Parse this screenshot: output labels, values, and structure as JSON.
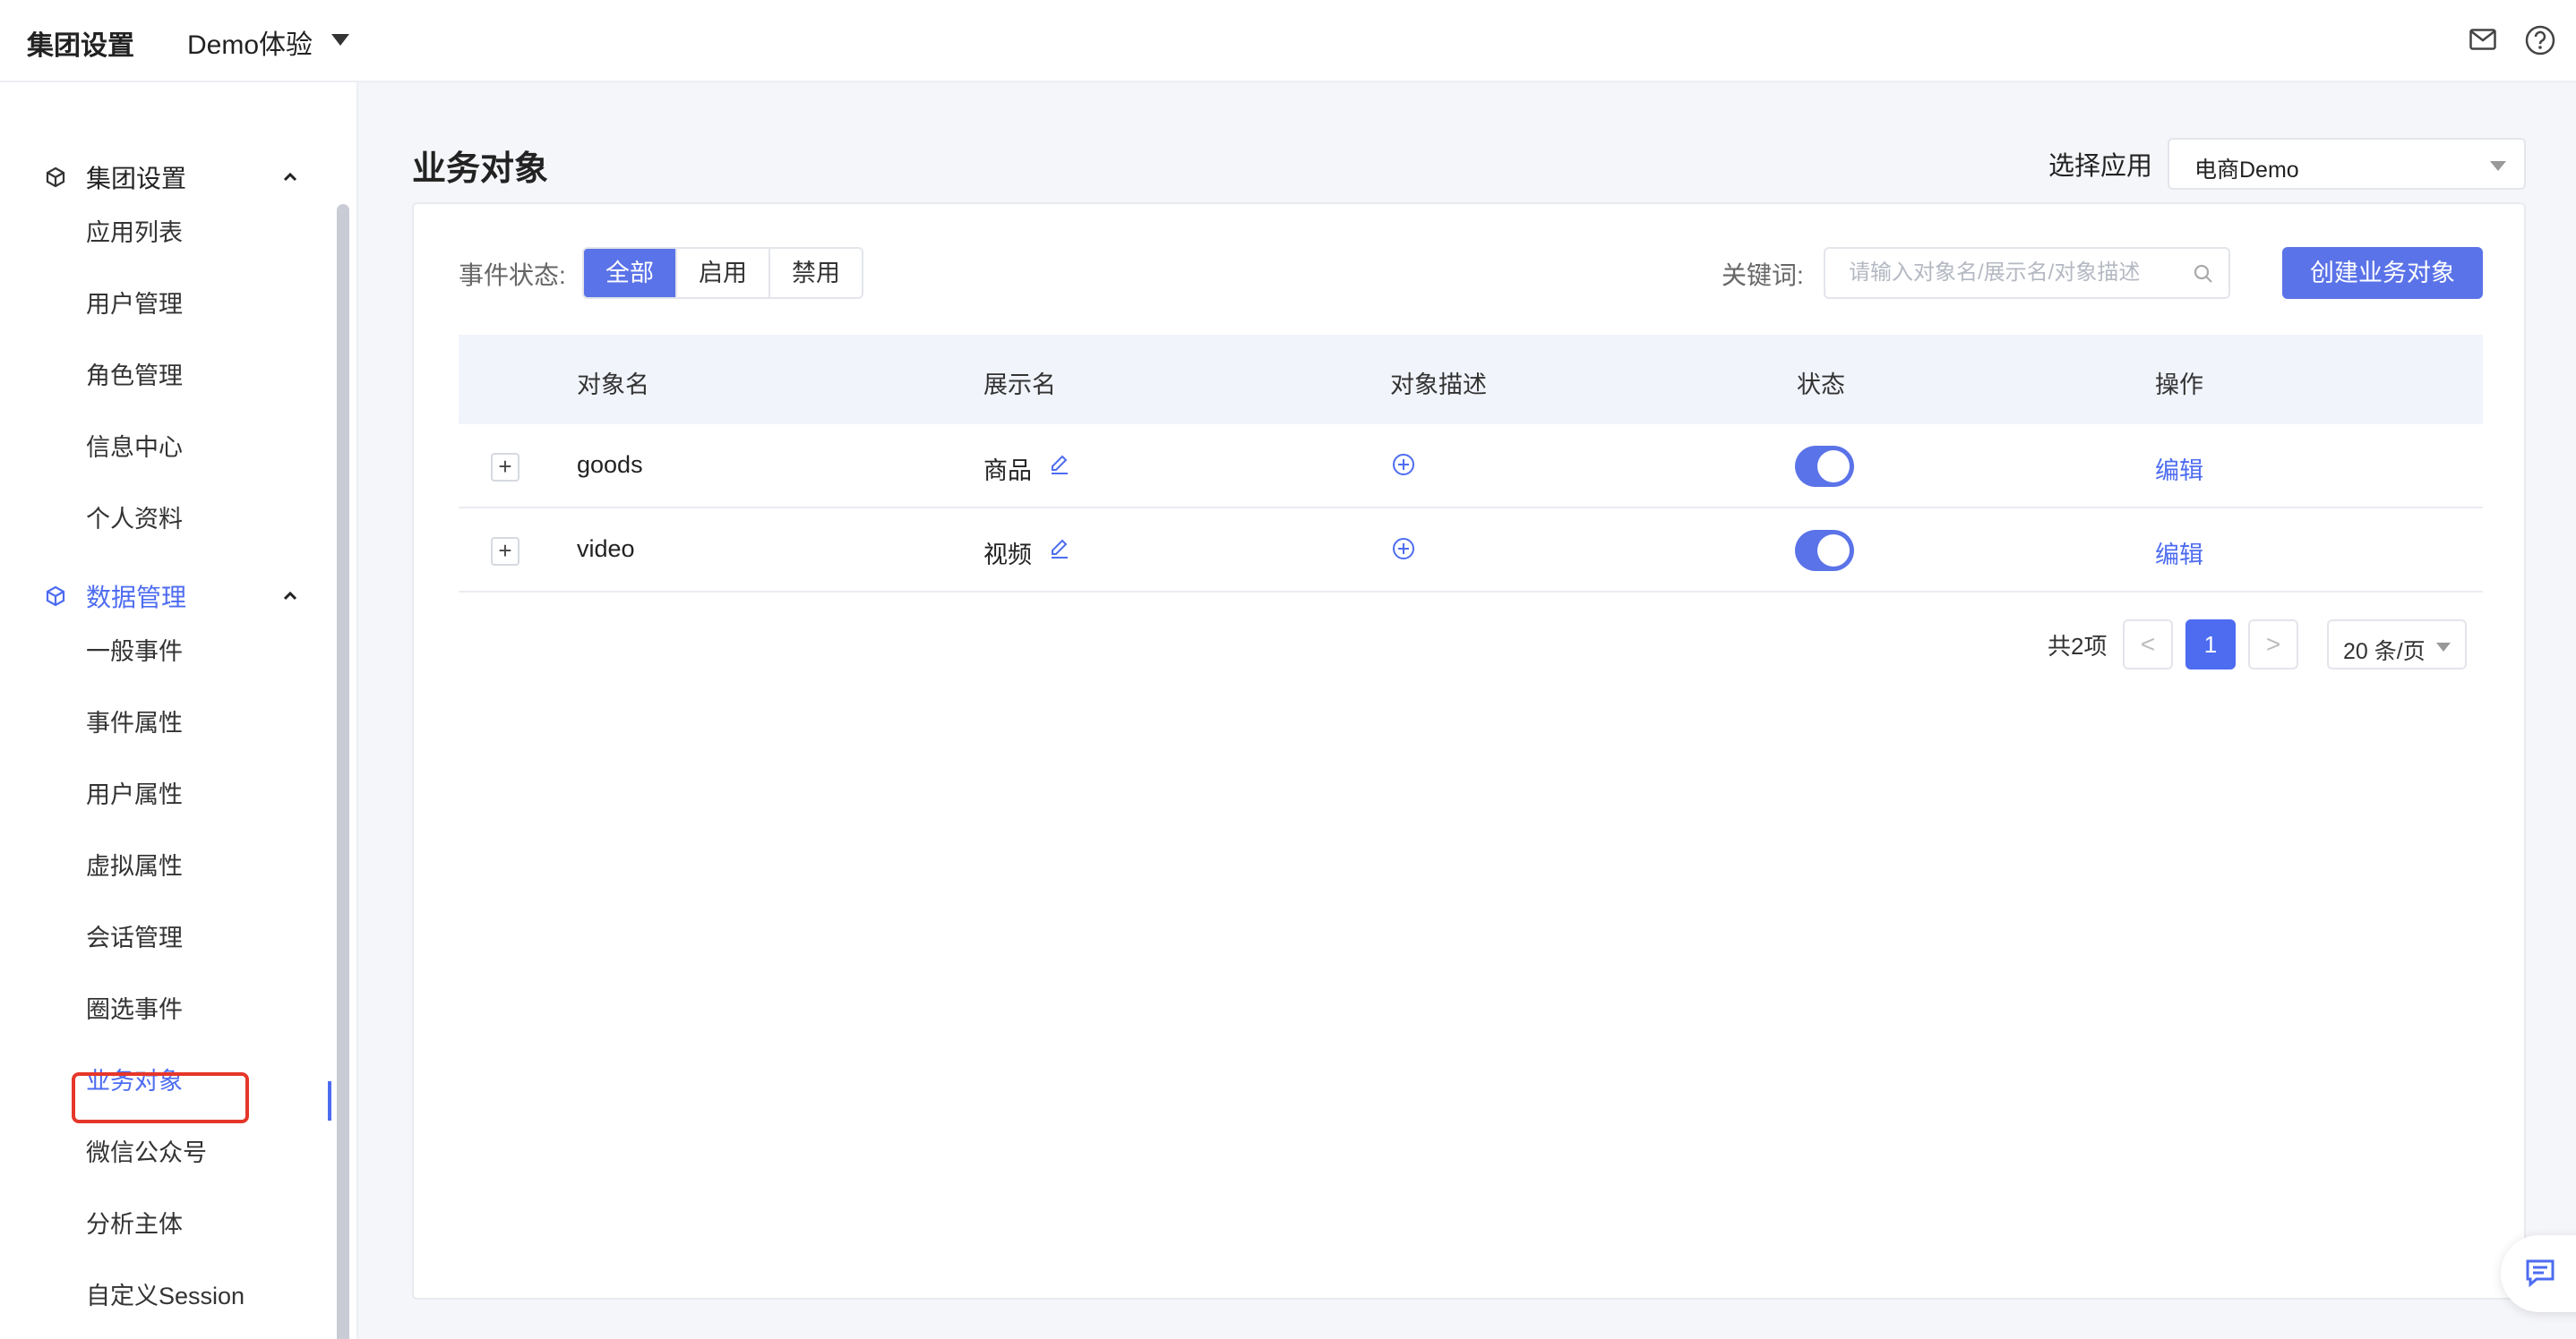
{
  "topbar": {
    "title": "集团设置",
    "project": "Demo体验",
    "icons": [
      "chevron-down-icon",
      "mail-icon",
      "help-icon"
    ]
  },
  "sidebar": {
    "groups": [
      {
        "label": "集团设置",
        "icon": "cube-icon",
        "expanded": true,
        "items": [
          "应用列表",
          "用户管理",
          "角色管理",
          "信息中心",
          "个人资料"
        ]
      },
      {
        "label": "数据管理",
        "icon": "cube-icon",
        "expanded": true,
        "active": true,
        "items": [
          "一般事件",
          "事件属性",
          "用户属性",
          "虚拟属性",
          "会话管理",
          "圈选事件",
          "业务对象",
          "微信公众号",
          "分析主体",
          "自定义Session"
        ]
      }
    ],
    "active_item": "业务对象"
  },
  "main": {
    "title": "业务对象",
    "app_select": {
      "label": "选择应用",
      "value": "电商Demo"
    },
    "filter": {
      "label": "事件状态:",
      "options": [
        "全部",
        "启用",
        "禁用"
      ],
      "selected": "全部"
    },
    "keyword": {
      "label": "关键词:",
      "placeholder": "请输入对象名/展示名/对象描述"
    },
    "create_button": "创建业务对象",
    "table": {
      "columns": [
        "对象名",
        "展示名",
        "对象描述",
        "状态",
        "操作"
      ],
      "rows": [
        {
          "name": "goods",
          "display": "商品",
          "enabled": true,
          "action": "编辑"
        },
        {
          "name": "video",
          "display": "视频",
          "enabled": true,
          "action": "编辑"
        }
      ]
    },
    "pagination": {
      "total": "共2项",
      "current_page": "1",
      "prev": "<",
      "next": ">",
      "page_size": "20 条/页"
    }
  },
  "colors": {
    "accent": "#5b73e8",
    "link": "#4d6cf0",
    "highlight_box": "#e6362a"
  }
}
